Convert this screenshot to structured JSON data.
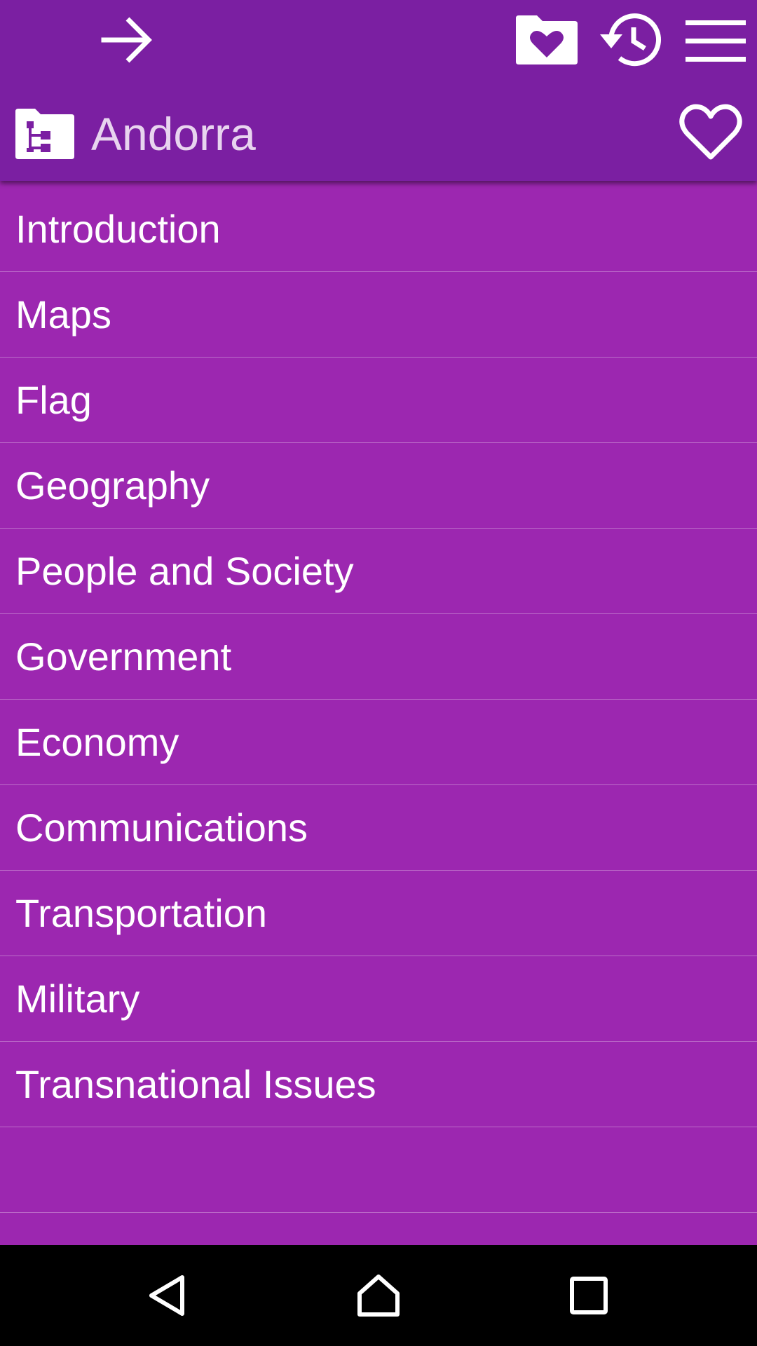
{
  "colors": {
    "appbar": "#7b1fa2",
    "list_background": "#9c27b0",
    "title_text": "#e8d4ef",
    "item_text": "#ffffff",
    "navbar": "#000000"
  },
  "toolbar": {
    "icons": [
      "arrow-forward-icon",
      "favorites-folder-icon",
      "history-icon",
      "menu-icon"
    ]
  },
  "header": {
    "icon": "sitemap-folder-icon",
    "title": "Andorra",
    "favorite_icon": "heart-outline-icon"
  },
  "list": {
    "items": [
      {
        "label": "Introduction"
      },
      {
        "label": "Maps"
      },
      {
        "label": "Flag"
      },
      {
        "label": "Geography"
      },
      {
        "label": "People and Society"
      },
      {
        "label": "Government"
      },
      {
        "label": "Economy"
      },
      {
        "label": "Communications"
      },
      {
        "label": "Transportation"
      },
      {
        "label": "Military"
      },
      {
        "label": "Transnational Issues"
      },
      {
        "label": ""
      }
    ]
  },
  "navigation_bar": {
    "icons": [
      "back-icon",
      "home-icon",
      "recent-apps-icon"
    ]
  }
}
